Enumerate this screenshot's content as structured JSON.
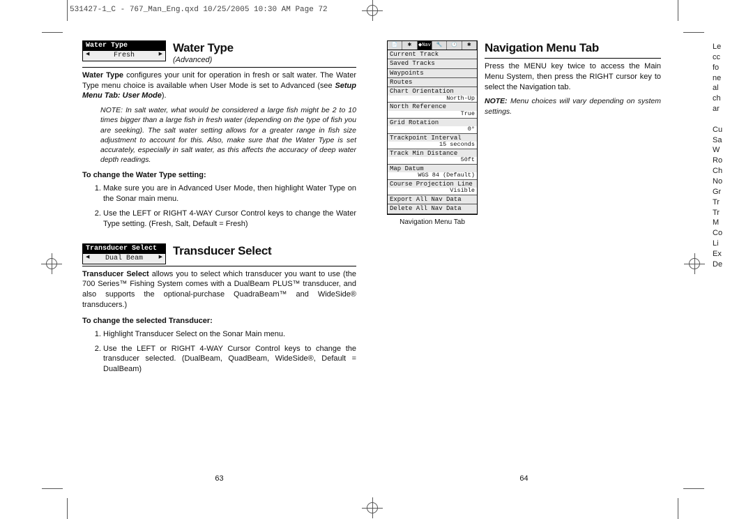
{
  "header": "531427-1_C - 767_Man_Eng.qxd  10/25/2005  10:30 AM  Page 72",
  "left": {
    "waterType": {
      "boxTitle": "Water Type",
      "boxValue": "Fresh",
      "title": "Water Type",
      "sub": "(Advanced)",
      "p1a": "Water Type",
      "p1b": " configures your unit for operation in fresh or salt water. The Water Type menu choice is available when User Mode is set to Advanced (see ",
      "p1c": "Setup Menu Tab: User Mode",
      "p1d": ").",
      "note": "NOTE:  In salt water, what would be considered a large fish might be 2 to 10 times bigger than a large fish in fresh water (depending on the type of fish you are seeking). The salt water setting allows for a greater range in fish size adjustment to account for this. Also, make sure that the Water Type is set accurately, especially in salt water, as this affects the accuracy of deep water depth readings.",
      "subhead": "To change the Water Type setting:",
      "step1": "Make sure you are in Advanced User Mode, then highlight Water Type on the Sonar main menu.",
      "step2": "Use the LEFT or RIGHT 4-WAY Cursor Control keys to change the Water Type setting. (Fresh, Salt, Default = Fresh)"
    },
    "transducer": {
      "boxTitle": "Transducer Select",
      "boxValue": "Dual Beam",
      "title": "Transducer Select",
      "p1a": "Transducer Select",
      "p1b": " allows you to select which transducer you want to use (the 700 Series™ Fishing System comes with a DualBeam PLUS™ transducer, and also supports the optional-purchase QuadraBeam™ and WideSide® transducers.)",
      "subhead": "To change the selected Transducer:",
      "step1": "Highlight Transducer Select on the Sonar Main menu.",
      "step2": "Use the LEFT or RIGHT 4-WAY Cursor Control keys to change the transducer selected. (DualBeam, QuadBeam, WideSide®, Default = DualBeam)"
    },
    "pageNum": "63"
  },
  "right": {
    "title": "Navigation Menu Tab",
    "p1": "Press the MENU key twice to access the Main Menu System, then press the RIGHT cursor key to select the Navigation tab.",
    "noteLabel": "NOTE:",
    "noteText": " Menu choices will vary depending on system settings.",
    "menu": {
      "tabs": [
        "📄",
        "✱",
        "◆Nav",
        "🔧",
        "🕐",
        "✱"
      ],
      "items": [
        {
          "label": "Current Track",
          "value": ""
        },
        {
          "label": "Saved Tracks",
          "value": ""
        },
        {
          "label": "Waypoints",
          "value": ""
        },
        {
          "label": "Routes",
          "value": ""
        },
        {
          "label": "Chart Orientation",
          "value": "North-Up"
        },
        {
          "label": "North Reference",
          "value": "True"
        },
        {
          "label": "Grid Rotation",
          "value": "0°"
        },
        {
          "label": "Trackpoint Interval",
          "value": "15 seconds"
        },
        {
          "label": "Track Min Distance",
          "value": "50ft"
        },
        {
          "label": "Map Datum",
          "value": "WGS 84 (Default)"
        },
        {
          "label": "Course Projection Line",
          "value": "Visible"
        },
        {
          "label": "Export All Nav Data",
          "value": ""
        },
        {
          "label": "Delete All Nav Data",
          "value": ""
        }
      ]
    },
    "caption": "Navigation Menu Tab",
    "pageNum": "64"
  },
  "cutoff": [
    "Le",
    "cc",
    "fo",
    "ne",
    "al",
    "ch",
    "ar",
    "",
    "Cu",
    "Sa",
    "W",
    "Ro",
    "Ch",
    "No",
    "Gr",
    "Tr",
    "Tr",
    "M",
    "Co",
    "Li",
    "Ex",
    "De"
  ]
}
